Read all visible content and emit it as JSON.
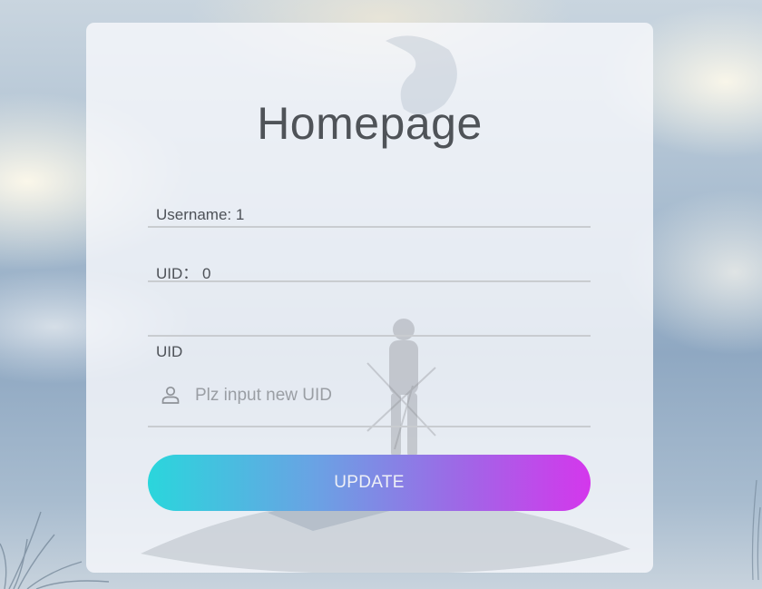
{
  "page": {
    "title": "Homepage"
  },
  "fields": {
    "username_text": "Username: 1",
    "uid_text": "UID： 0",
    "empty_text": ""
  },
  "uid_input": {
    "label": "UID",
    "placeholder": "Plz input new UID",
    "value": ""
  },
  "actions": {
    "update_label": "UPDATE"
  },
  "colors": {
    "button_gradient_start": "#2ad6dc",
    "button_gradient_end": "#d437ec",
    "card_background": "#f6f8fb",
    "title_text": "#4f5358"
  },
  "icons": {
    "uid_input_icon": "user-icon"
  }
}
